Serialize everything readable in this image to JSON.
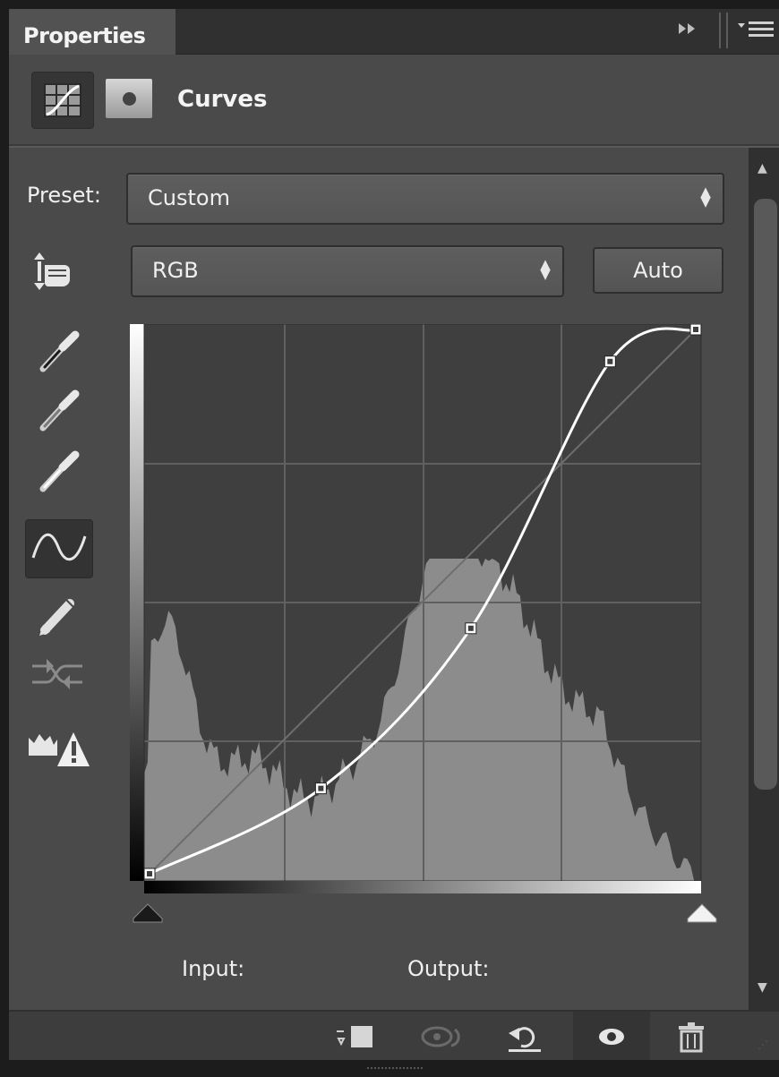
{
  "panel": {
    "tab_title": "Properties",
    "header_title": "Curves"
  },
  "preset": {
    "label": "Preset:",
    "value": "Custom"
  },
  "channel": {
    "value": "RGB"
  },
  "auto_button": {
    "label": "Auto"
  },
  "tools": [
    {
      "name": "on-image-adjust-icon"
    },
    {
      "name": "black-point-eyedropper-icon"
    },
    {
      "name": "gray-point-eyedropper-icon"
    },
    {
      "name": "white-point-eyedropper-icon"
    },
    {
      "name": "smooth-curve-icon",
      "selected": true
    },
    {
      "name": "pencil-draw-icon"
    },
    {
      "name": "smooth-points-icon",
      "disabled": true
    },
    {
      "name": "clipping-warning-icon"
    }
  ],
  "curve": {
    "points": [
      [
        0,
        0
      ],
      [
        80,
        40
      ],
      [
        150,
        115
      ],
      [
        215,
        240
      ],
      [
        255,
        255
      ]
    ],
    "input_label": "Input:",
    "output_label": "Output:"
  },
  "footer": {
    "icons": [
      "clip-to-layer-icon",
      "view-previous-state-icon",
      "reset-icon",
      "visibility-eye-icon",
      "trash-icon"
    ]
  },
  "colors": {
    "panel_bg": "#4a4a4a",
    "graph_bg": "#3f3f3f",
    "histogram": "#8c8c8c",
    "curve": "#ffffff"
  }
}
